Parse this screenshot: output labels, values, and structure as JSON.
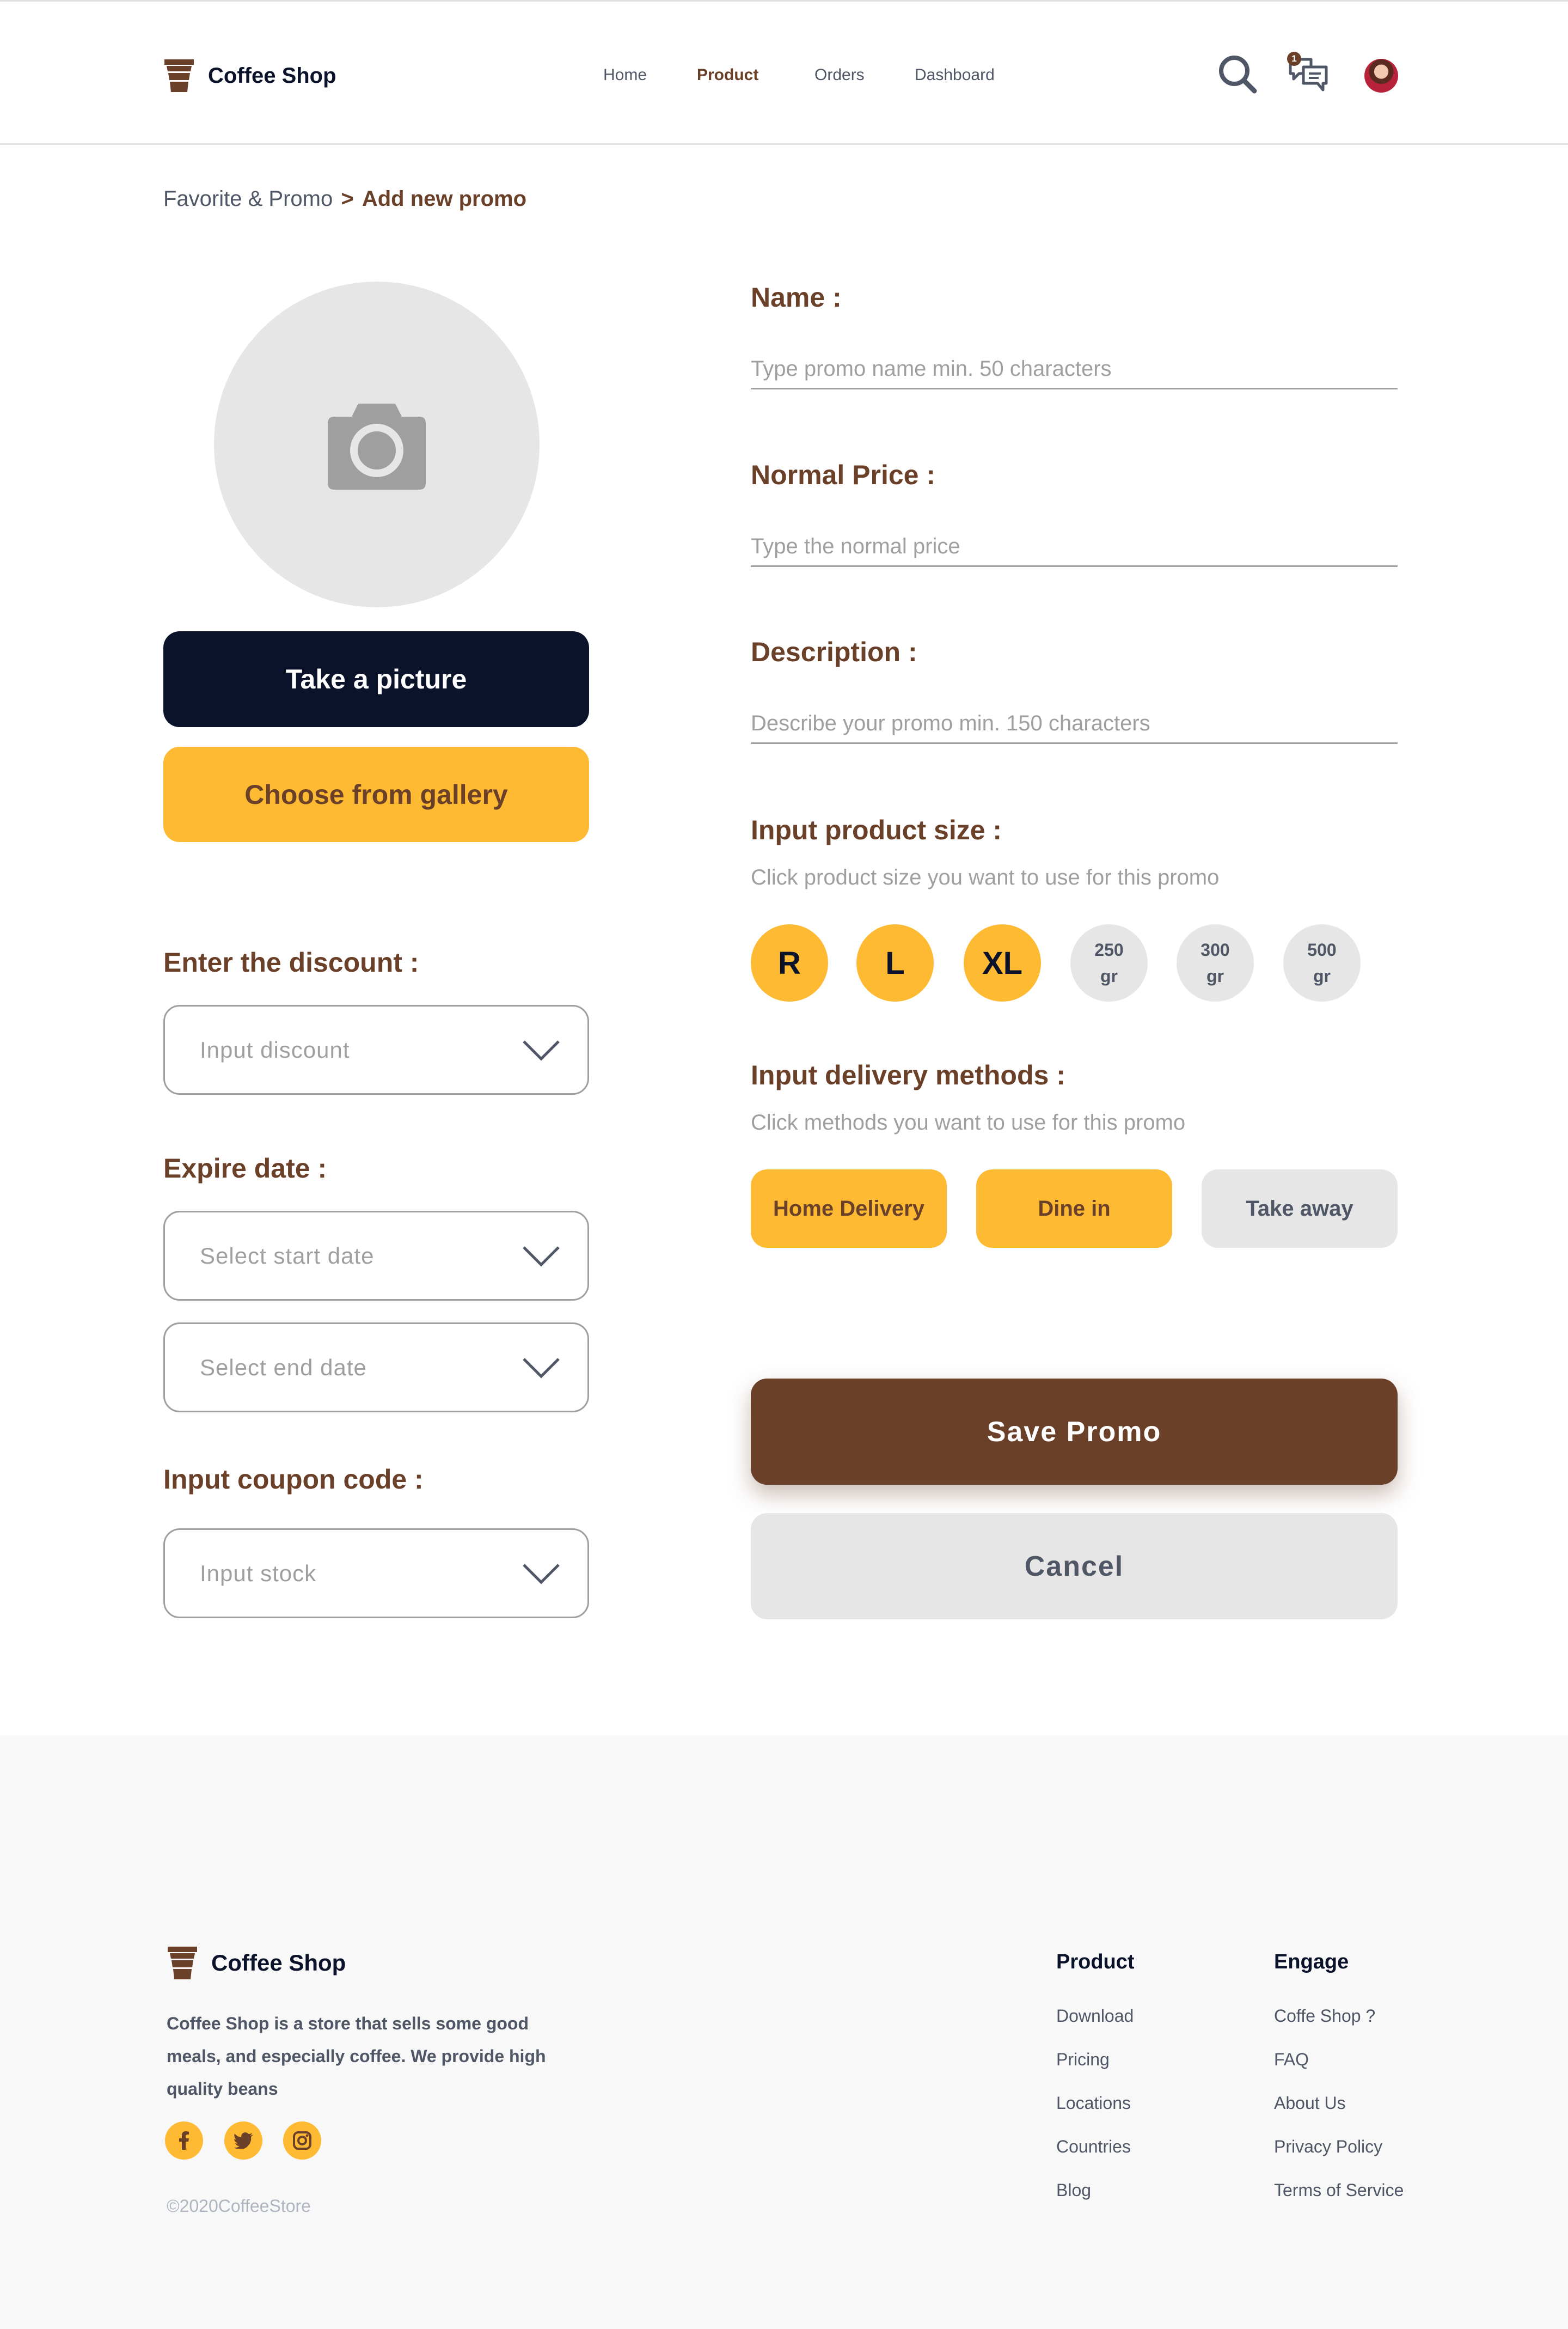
{
  "brand": {
    "name": "Coffee Shop"
  },
  "nav": {
    "items": [
      "Home",
      "Product",
      "Orders",
      "Dashboard"
    ],
    "active": "Product"
  },
  "header": {
    "chat_badge": "1"
  },
  "breadcrumb": {
    "parent": "Favorite & Promo",
    "separator": ">",
    "current": "Add new promo"
  },
  "photo": {
    "icon": "camera-icon"
  },
  "buttons": {
    "take_picture": "Take a picture",
    "choose_gallery": "Choose from gallery",
    "save": "Save Promo",
    "cancel": "Cancel"
  },
  "left_form": {
    "discount_label": "Enter the discount :",
    "discount_placeholder": "Input discount",
    "expire_label": "Expire date :",
    "start_placeholder": "Select start date",
    "end_placeholder": "Select end date",
    "coupon_label": "Input coupon code :",
    "coupon_placeholder": "Input stock"
  },
  "right_form": {
    "name_label": "Name :",
    "name_placeholder": "Type promo name min. 50 characters",
    "price_label": "Normal Price :",
    "price_placeholder": "Type the normal price",
    "description_label": "Description :",
    "description_placeholder": "Describe your promo min. 150 characters",
    "size_label": "Input product size :",
    "size_hint": "Click product size you want to use for this promo",
    "sizes": [
      {
        "label": "R",
        "selected": true
      },
      {
        "label": "L",
        "selected": true
      },
      {
        "label": "XL",
        "selected": true
      },
      {
        "label": "250",
        "unit": "gr",
        "selected": false
      },
      {
        "label": "300",
        "unit": "gr",
        "selected": false
      },
      {
        "label": "500",
        "unit": "gr",
        "selected": false
      }
    ],
    "delivery_label": "Input delivery methods :",
    "delivery_hint": "Click methods you want to use for this promo",
    "methods": [
      {
        "label": "Home Delivery",
        "selected": true
      },
      {
        "label": "Dine in",
        "selected": true
      },
      {
        "label": "Take away",
        "selected": false
      }
    ]
  },
  "footer": {
    "brand": "Coffee Shop",
    "description": "Coffee Shop is a store that sells some good meals, and especially coffee. We provide high quality beans",
    "social": [
      "facebook-icon",
      "twitter-icon",
      "instagram-icon"
    ],
    "copyright": "©2020CoffeeStore",
    "product_title": "Product",
    "product_links": [
      "Download",
      "Pricing",
      "Locations",
      "Countries",
      "Blog"
    ],
    "engage_title": "Engage",
    "engage_links": [
      "Coffe Shop ?",
      "FAQ",
      "About Us",
      "Privacy Policy",
      "Terms of Service"
    ]
  },
  "colors": {
    "brown": "#6A4029",
    "yellow": "#FFBA33",
    "navy": "#0B132A",
    "grey": "#E6E6E6"
  }
}
